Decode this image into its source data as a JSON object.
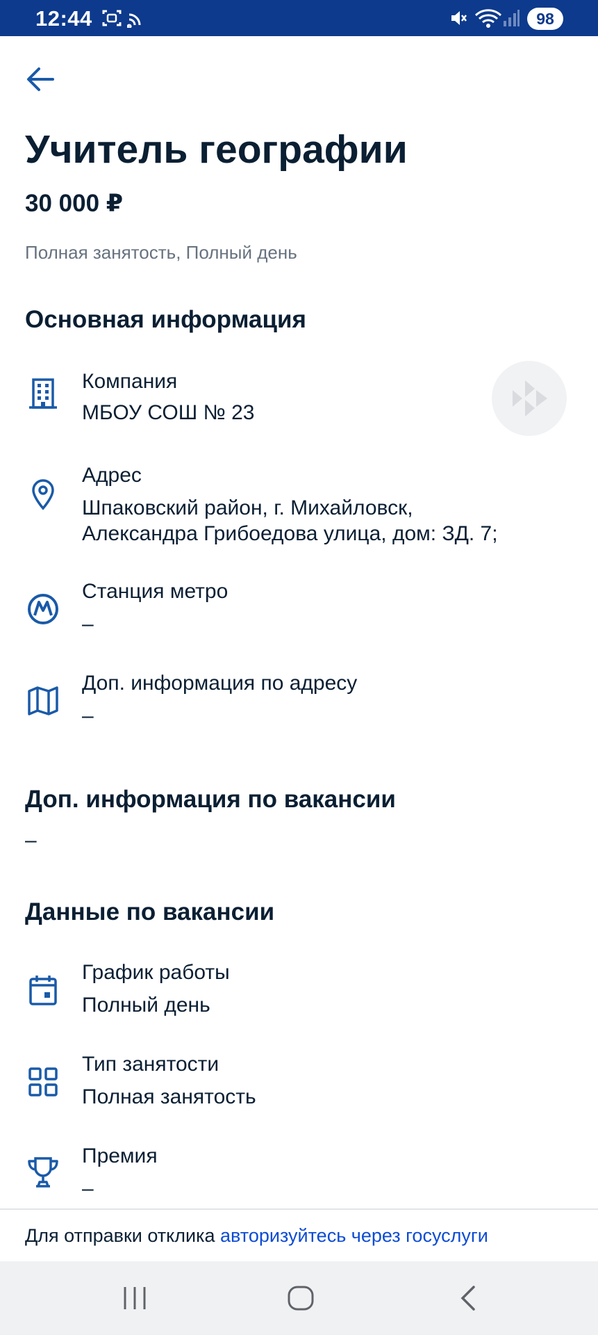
{
  "status_bar": {
    "time": "12:44",
    "battery": "98",
    "icons": [
      "screenshot-icon",
      "cast-icon",
      "mute-icon",
      "wifi-icon",
      "signal-icon"
    ]
  },
  "header": {
    "back_icon": "arrow-left-icon"
  },
  "vacancy": {
    "title": "Учитель географии",
    "salary": "30 000 ₽",
    "employment": "Полная занятость, Полный день"
  },
  "main_info": {
    "title": "Основная информация",
    "company": {
      "label": "Компания",
      "value": "МБОУ СОШ № 23",
      "icon": "building-icon"
    },
    "address": {
      "label": "Адрес",
      "value_line1": "Шпаковский район, г. Михайловск,",
      "value_line2": "Александра Грибоедова улица, дом: ЗД. 7;",
      "icon": "location-pin-icon"
    },
    "metro": {
      "label": "Станция метро",
      "value": "–",
      "icon": "metro-icon"
    },
    "address_extra": {
      "label": "Доп. информация по адресу",
      "value": "–",
      "icon": "map-icon"
    }
  },
  "vacancy_extra": {
    "title": "Доп. информация по вакансии",
    "value": "–"
  },
  "vacancy_data": {
    "title": "Данные по вакансии",
    "schedule": {
      "label": "График работы",
      "value": "Полный день",
      "icon": "calendar-icon"
    },
    "employment_type": {
      "label": "Тип занятости",
      "value": "Полная занятость",
      "icon": "grid-icon"
    },
    "bonus": {
      "label": "Премия",
      "value": "–",
      "icon": "trophy-icon"
    }
  },
  "footer": {
    "text": "Для отправки отклика ",
    "link": "авторизуйтесь через госуслуги"
  },
  "colors": {
    "status_bar": "#0d3a8c",
    "accent_icon": "#1a5aa8",
    "link": "#0d4cd3",
    "muted_text": "#66727f"
  }
}
